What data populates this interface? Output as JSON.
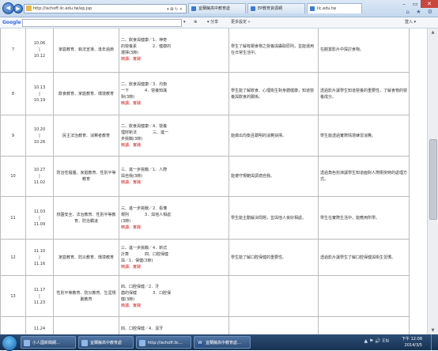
{
  "browser": {
    "address": "http://ischoff.ilc.edu.tw/ep.jsp",
    "address_tools": "▾ ⊠ ↻ ×",
    "tabs": [
      "宜蘭縣高中教育處",
      "EP教育資源網",
      "ilc.edu.tw"
    ],
    "window_controls": {
      "minimize": "–",
      "restore": "▭",
      "close": "✕"
    },
    "icons": "⌂ ★ ⚙"
  },
  "toolbar": {
    "google_logo": "Google",
    "items": [
      "▾",
      "⊕",
      "▾ 分享",
      "更多設定 »"
    ],
    "login": "登入 ▾"
  },
  "schedule": {
    "rows": [
      {
        "week": "7",
        "dates": [
          "10.06",
          "|",
          "10.12"
        ],
        "topic": "家庭教育、執法宣導、逢年過節",
        "content": [
          "二、飲食與健康／1．神奇",
          "的營養素　　　　2．健康的",
          "選擇(3節)"
        ],
        "content_red": [
          "精讀、實踐"
        ],
        "goal": "學生了解有關食物之營養與攝取原則，並能運用在日常生活中。",
        "outcome": "在觀賞影片中探討食物。"
      },
      {
        "week": "8",
        "dates": [
          "10.13",
          "|",
          "10.19"
        ],
        "topic": "飲食教育、家庭教育、環境教育",
        "content": [
          "二、飲食與健康／3．均衡",
          "一下　　　　4．營養知識",
          "對(3節)"
        ],
        "content_red": [
          "精讀、實踐"
        ],
        "goal": "學生能了解飲食、心理衛生對身體健康，知道營養與飲食的關係。",
        "outcome": "透過影片讓學生知道營養的重要性，了解食物的營養成分。"
      },
      {
        "week": "9",
        "dates": [
          "10.20",
          "|",
          "10.26"
        ],
        "topic": "民主法治教育、消費者教育",
        "content": [
          "二、飲食與健康／4．營養",
          "理財新法　　　　三、進一",
          "步挑戰(3節)"
        ],
        "content_red": [
          "精讀、實踐"
        ],
        "goal": "能做出均衡且聰明的消費抉擇。",
        "outcome": "學生能透過實際情境練習消費。"
      },
      {
        "week": "10",
        "dates": [
          "10.27",
          "|",
          "11.02"
        ],
        "topic": "防治性騷擾、家庭教育、性別平等教育",
        "content": [
          "三、進一步挑戰／1．人際",
          "與自我(3節)"
        ],
        "content_red": [
          "精讀、實踐"
        ],
        "goal": "能遵守規範與調適自我。",
        "outcome": "透過角色扮演讓學生知道面對人際衝突時的處理方式。"
      },
      {
        "week": "11",
        "dates": [
          "11.03",
          "|",
          "11.09"
        ],
        "topic": "校園安全、法治教育、性別平等教育、防治霸凌",
        "content": [
          "三、進一步挑戰／2．看懂",
          "規則　　　　3．與他人相處",
          "(3節)"
        ],
        "content_red": [
          "精讀、實踐"
        ],
        "goal": "學生能主動解決問題，並與他人良好相處。",
        "outcome": "學生在實際生活中，能應用所學。"
      },
      {
        "week": "12",
        "dates": [
          "11.10",
          "|",
          "11.16"
        ],
        "topic": "家庭教育、防災教育、環境教育",
        "content": [
          "三、進一步挑戰／4．新式",
          "計算　　　　四、口腔保健",
          "與／1．保健(3節)"
        ],
        "content_red": [
          "精讀、實踐"
        ],
        "goal": "學生能了解口腔保健的重要性。",
        "outcome": "透過影片讓學生了解口腔保健與衛生習慣。"
      },
      {
        "week": "13",
        "dates": [
          "11.17",
          "|",
          "11.23"
        ],
        "topic": "性別平等教育、防災教育、生涯規劃教育",
        "content": [
          "四、口腔保健／2．牙",
          "齒的保健　　　　3．口腔保",
          "健(3節)"
        ],
        "content_red": [
          "精讀、實踐"
        ],
        "goal": "",
        "outcome": ""
      },
      {
        "week": "",
        "dates": [
          "11.24"
        ],
        "topic": "",
        "content": [
          "四、口腔保健／4．潔牙"
        ],
        "content_red": [],
        "goal": "",
        "outcome": ""
      }
    ]
  },
  "taskbar": {
    "buttons": [
      "小人國新聞網…",
      "宜蘭縣高中教育處",
      "http://ischoff.ilc…",
      "宜蘭縣高中教育處…"
    ],
    "tray_icons": "▲ ⚑ 🔊 EN",
    "time": "下午 12:08",
    "date": "2014/3/5"
  }
}
